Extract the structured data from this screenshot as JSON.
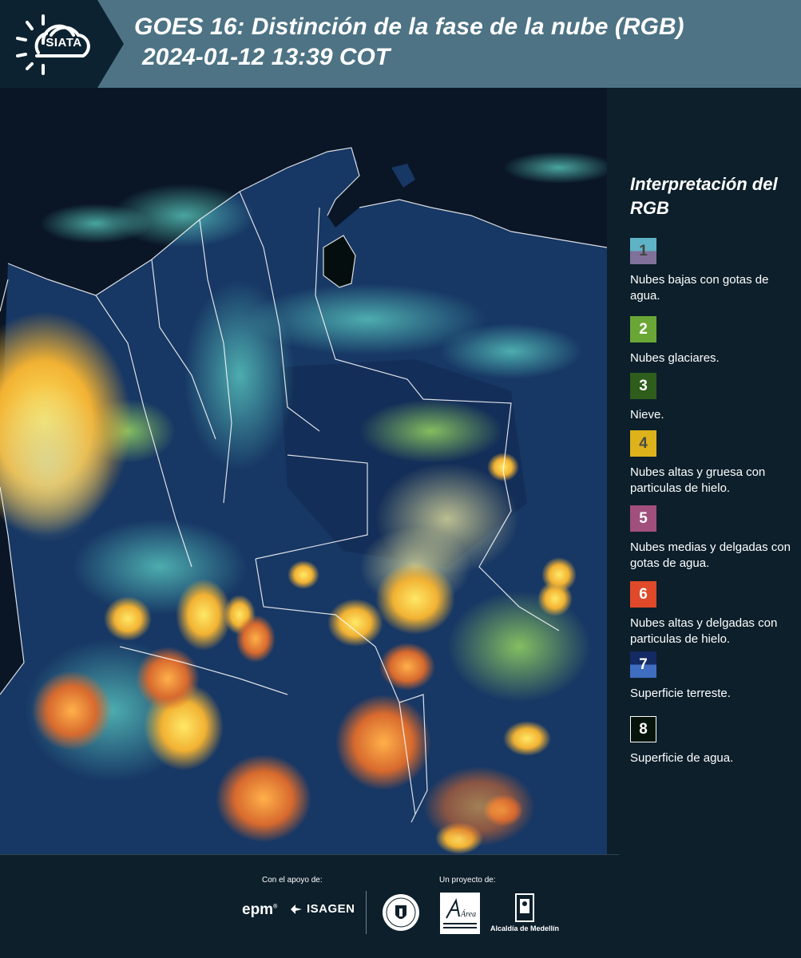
{
  "header": {
    "logo_text": "SIATA",
    "title_line1": "GOES 16: Distinción de la fase de la nube (RGB)",
    "title_line2": "2024-01-12 13:39 COT"
  },
  "map": {
    "description_icon": "satellite-rgb-composite",
    "ocean_color": "#0a1626",
    "land_color": "#173764",
    "border_color": "#ffffff"
  },
  "legend": {
    "title": "Interpretación del RGB",
    "items": [
      {
        "num": "1",
        "label": "Nubes bajas con gotas de agua.",
        "color_top": "#5fb3c6",
        "color_bottom": "#7f7199",
        "num_color": "#444444"
      },
      {
        "num": "2",
        "label": "Nubes glaciares.",
        "color_top": "#6aa635",
        "color_bottom": "#6aa635",
        "num_color": "#ffffff"
      },
      {
        "num": "3",
        "label": "Nieve.",
        "color_top": "#2e5d1c",
        "color_bottom": "#2e5d1c",
        "num_color": "#ffffff"
      },
      {
        "num": "4",
        "label": "Nubes altas y gruesa con particulas de hielo.",
        "color_top": "#ddb21b",
        "color_bottom": "#ddb21b",
        "num_color": "#4a4a4a"
      },
      {
        "num": "5",
        "label": "Nubes medias y delgadas con gotas de agua.",
        "color_top": "#a14f7c",
        "color_bottom": "#a14f7c",
        "num_color": "#ffffff"
      },
      {
        "num": "6",
        "label": "Nubes altas y delgadas con particulas de hielo.",
        "color_top": "#e0492a",
        "color_bottom": "#e0492a",
        "num_color": "#ffffff"
      },
      {
        "num": "7",
        "label": "Superficie terreste.",
        "color_top": "#142a63",
        "color_bottom": "#3f6dc0",
        "num_color": "#ffffff"
      },
      {
        "num": "8",
        "label": "Superficie de agua.",
        "color_top": "#06140c",
        "color_bottom": "#06140c",
        "num_color": "#ffffff"
      }
    ]
  },
  "footer": {
    "support_label": "Con el apoyo de:",
    "project_label": "Un proyecto de:",
    "epm_logo": "epm",
    "isagen_logo": "ISAGEN",
    "area_logo_text": "Área",
    "alcaldia_text": "Alcaldía de Medellín"
  }
}
